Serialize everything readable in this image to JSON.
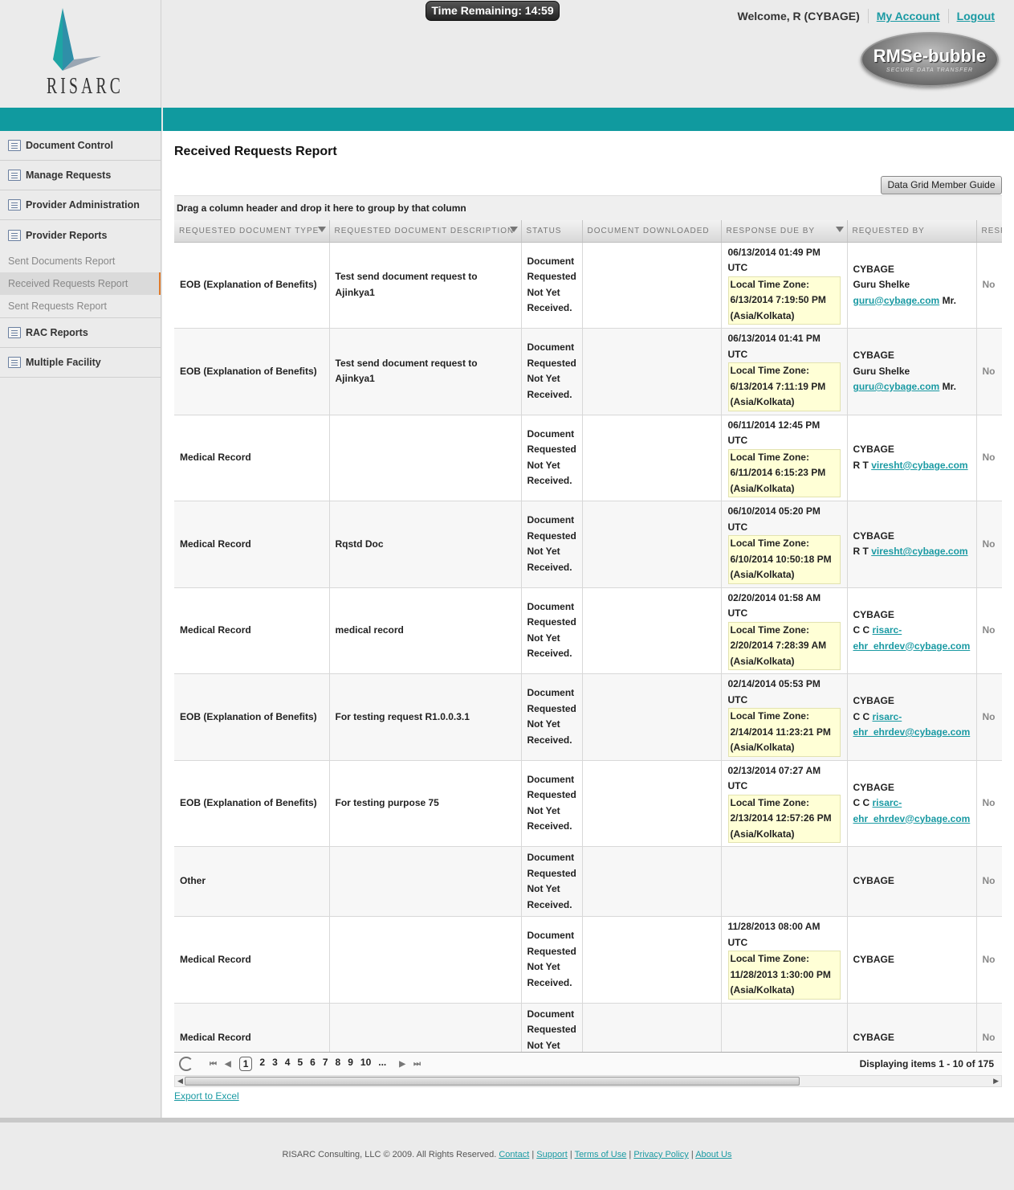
{
  "header": {
    "logo_text": "RISARC",
    "timer": "Time Remaining: 14:59",
    "welcome": "Welcome, R (CYBAGE)",
    "my_account": "My Account",
    "logout": "Logout",
    "badge_title": "RMSe-bubble",
    "badge_subtitle": "SECURE DATA TRANSFER"
  },
  "sidebar": {
    "items": [
      {
        "label": "Document Control"
      },
      {
        "label": "Manage Requests"
      },
      {
        "label": "Provider Administration"
      },
      {
        "label": "Provider Reports"
      }
    ],
    "sub_items": [
      {
        "label": "Sent Documents Report"
      },
      {
        "label": "Received Requests Report"
      },
      {
        "label": "Sent Requests Report"
      }
    ],
    "items2": [
      {
        "label": "RAC Reports"
      },
      {
        "label": "Multiple Facility"
      }
    ]
  },
  "main": {
    "title": "Received Requests Report",
    "guide_button": "Data Grid Member Guide",
    "group_hint": "Drag a column header and drop it here to group by that column",
    "columns": [
      "REQUESTED DOCUMENT TYPE",
      "REQUESTED DOCUMENT DESCRIPTION",
      "STATUS",
      "DOCUMENT DOWNLOADED",
      "RESPONSE DUE BY",
      "REQUESTED BY",
      "RESPONDED"
    ],
    "rows": [
      {
        "type": "EOB (Explanation of Benefits)",
        "desc": "Test send document request to Ajinkya1",
        "status": "Document Requested Not Yet Received.",
        "downloaded": "",
        "due": "06/13/2014 01:49 PM UTC",
        "ltz_label": "Local Time Zone:",
        "ltz_time": "6/13/2014 7:19:50 PM",
        "ltz_zone": "(Asia/Kolkata)",
        "org": "CYBAGE",
        "name": "Guru Shelke",
        "email": "guru@cybage.com",
        "suffix": "Mr.",
        "resp": "No"
      },
      {
        "type": "EOB (Explanation of Benefits)",
        "desc": "Test send document request to Ajinkya1",
        "status": "Document Requested Not Yet Received.",
        "downloaded": "",
        "due": "06/13/2014 01:41 PM UTC",
        "ltz_label": "Local Time Zone:",
        "ltz_time": "6/13/2014 7:11:19 PM",
        "ltz_zone": "(Asia/Kolkata)",
        "org": "CYBAGE",
        "name": "Guru Shelke",
        "email": "guru@cybage.com",
        "suffix": "Mr.",
        "resp": "No"
      },
      {
        "type": "Medical Record",
        "desc": "",
        "status": "Document Requested Not Yet Received.",
        "downloaded": "",
        "due": "06/11/2014 12:45 PM UTC",
        "ltz_label": "Local Time Zone:",
        "ltz_time": "6/11/2014 6:15:23 PM",
        "ltz_zone": "(Asia/Kolkata)",
        "org": "CYBAGE",
        "name": "R T",
        "email": "viresht@cybage.com",
        "suffix": "",
        "resp": "No"
      },
      {
        "type": "Medical Record",
        "desc": "Rqstd Doc",
        "status": "Document Requested Not Yet Received.",
        "downloaded": "",
        "due": "06/10/2014 05:20 PM UTC",
        "ltz_label": "Local Time Zone:",
        "ltz_time": "6/10/2014 10:50:18 PM",
        "ltz_zone": "(Asia/Kolkata)",
        "org": "CYBAGE",
        "name": "R T",
        "email": "viresht@cybage.com",
        "suffix": "",
        "resp": "No"
      },
      {
        "type": "Medical Record",
        "desc": "medical record",
        "status": "Document Requested Not Yet Received.",
        "downloaded": "",
        "due": "02/20/2014 01:58 AM UTC",
        "ltz_label": "Local Time Zone:",
        "ltz_time": "2/20/2014 7:28:39 AM",
        "ltz_zone": "(Asia/Kolkata)",
        "org": "CYBAGE",
        "name": "C C",
        "email": "risarc-ehr_ehrdev@cybage.com",
        "suffix": "",
        "resp": "No"
      },
      {
        "type": "EOB (Explanation of Benefits)",
        "desc": "For testing request R1.0.0.3.1",
        "status": "Document Requested Not Yet Received.",
        "downloaded": "",
        "due": "02/14/2014 05:53 PM UTC",
        "ltz_label": "Local Time Zone:",
        "ltz_time": "2/14/2014 11:23:21 PM",
        "ltz_zone": "(Asia/Kolkata)",
        "org": "CYBAGE",
        "name": "C C",
        "email": "risarc-ehr_ehrdev@cybage.com",
        "suffix": "",
        "resp": "No"
      },
      {
        "type": "EOB (Explanation of Benefits)",
        "desc": "For testing purpose 75",
        "status": "Document Requested Not Yet Received.",
        "downloaded": "",
        "due": "02/13/2014 07:27 AM UTC",
        "ltz_label": "Local Time Zone:",
        "ltz_time": "2/13/2014 12:57:26 PM",
        "ltz_zone": "(Asia/Kolkata)",
        "org": "CYBAGE",
        "name": "C C",
        "email": "risarc-ehr_ehrdev@cybage.com",
        "suffix": "",
        "resp": "No"
      },
      {
        "type": "Other",
        "desc": "",
        "status": "Document Requested Not Yet Received.",
        "downloaded": "",
        "due": "",
        "ltz_label": "",
        "ltz_time": "",
        "ltz_zone": "",
        "org": "CYBAGE",
        "name": "",
        "email": "",
        "suffix": "",
        "resp": "No"
      },
      {
        "type": "Medical Record",
        "desc": "",
        "status": "Document Requested Not Yet Received.",
        "downloaded": "",
        "due": "11/28/2013 08:00 AM UTC",
        "ltz_label": "Local Time Zone:",
        "ltz_time": "11/28/2013 1:30:00 PM",
        "ltz_zone": "(Asia/Kolkata)",
        "org": "CYBAGE",
        "name": "",
        "email": "",
        "suffix": "",
        "resp": "No"
      },
      {
        "type": "Medical Record",
        "desc": "",
        "status": "Document Requested Not Yet Received.",
        "downloaded": "",
        "due": "",
        "ltz_label": "",
        "ltz_time": "",
        "ltz_zone": "",
        "org": "CYBAGE",
        "name": "",
        "email": "",
        "suffix": "",
        "resp": "No"
      }
    ],
    "pager": {
      "pages": [
        "1",
        "2",
        "3",
        "4",
        "5",
        "6",
        "7",
        "8",
        "9",
        "10",
        "..."
      ],
      "current": "1",
      "info": "Displaying items 1 - 10 of 175"
    },
    "export": "Export to Excel"
  },
  "footer": {
    "copyright": "RISARC Consulting, LLC © 2009. All Rights Reserved.",
    "links": [
      "Contact",
      "Support",
      "Terms of Use",
      "Privacy Policy",
      "About Us"
    ]
  },
  "colors": {
    "teal": "#109a9f",
    "link": "#1a9aa3",
    "active_marker": "#e07a2a",
    "highlight": "#ffffd6"
  }
}
